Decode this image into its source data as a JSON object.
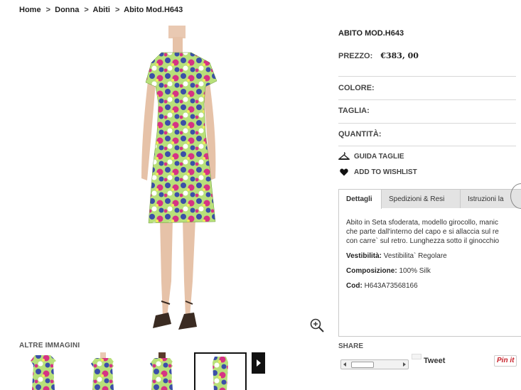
{
  "breadcrumb": {
    "home": "Home",
    "women": "Donna",
    "dresses": "Abiti",
    "current": "Abito Mod.H643",
    "separator": ">"
  },
  "product": {
    "title": "ABITO MOD.H643",
    "price_label": "PREZZO:",
    "price_value": "€383, 00",
    "options": {
      "color_label": "COLORE:",
      "size_label": "TAGLIA:",
      "quantity_label": "QUANTITÀ:"
    },
    "links": {
      "size_guide": "GUIDA TAGLIE",
      "wishlist": "ADD TO WISHLIST"
    }
  },
  "gallery": {
    "other_images_label": "ALTRE IMMAGINI",
    "thumbnail_count": 4,
    "selected_thumbnail": 4
  },
  "tabs": {
    "items": [
      {
        "label": "Dettagli"
      },
      {
        "label": "Spedizioni & Resi"
      },
      {
        "label": "Istruzioni la"
      }
    ],
    "active": 0,
    "content": {
      "desc_line1": "Abito in Seta sfoderata, modello girocollo, manic",
      "desc_line2": "che parte dall'interno del capo e si allaccia sul re",
      "desc_line3": "con carre` sul retro. Lunghezza sotto il ginocchio",
      "fit_label": "Vestibilità:",
      "fit_value": "Vestibilita` Regolare",
      "composition_label": "Composizione:",
      "composition_value": "100% Silk",
      "code_label": "Cod:",
      "code_value": "H643A73568166"
    }
  },
  "share": {
    "label": "SHARE",
    "tweet": "Tweet",
    "pinterest": "Pin it"
  },
  "colors": {
    "dress_green": "#9ad85a",
    "dress_blue": "#3b4fa8",
    "dress_pink": "#d63384",
    "border": "#c9c9c9",
    "inactive_tab": "#e3e3e3"
  }
}
